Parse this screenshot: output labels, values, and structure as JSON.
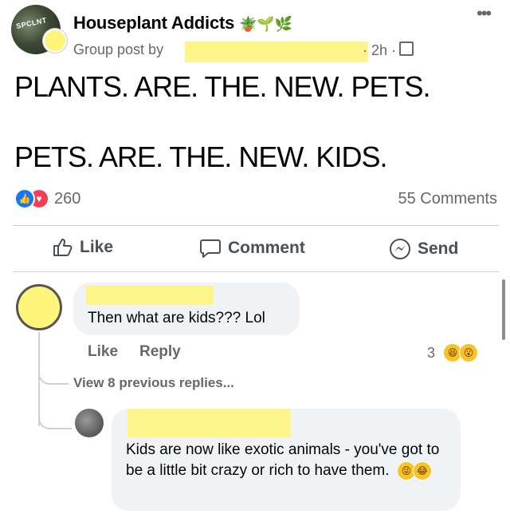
{
  "post": {
    "group_name": "Houseplant Addicts",
    "group_emojis": "🪴🌱🌿",
    "group_avatar_text": "SPCLNT",
    "subline": "Group post by",
    "time": "· 2h ·",
    "lines": [
      "PLANTS. ARE. THE. NEW. PETS.",
      "PETS. ARE. THE. NEW. KIDS."
    ],
    "reaction_count": "260",
    "comments_count": "55 Comments"
  },
  "actions": {
    "like": "Like",
    "comment": "Comment",
    "send": "Send"
  },
  "comments": [
    {
      "text": "Then what are kids??? Lol",
      "like_label": "Like",
      "reply_label": "Reply",
      "reaction_count": "3"
    }
  ],
  "view_previous": "View 8 previous replies...",
  "reply": {
    "text": "Kids are now like exotic animals - you've got to be a little bit crazy or rich to have them."
  },
  "colors": {
    "brand_blue": "#1877f2",
    "love_red": "#f33e58",
    "redaction_yellow": "#fdf48a",
    "bubble_gray": "#f0f2f5"
  }
}
